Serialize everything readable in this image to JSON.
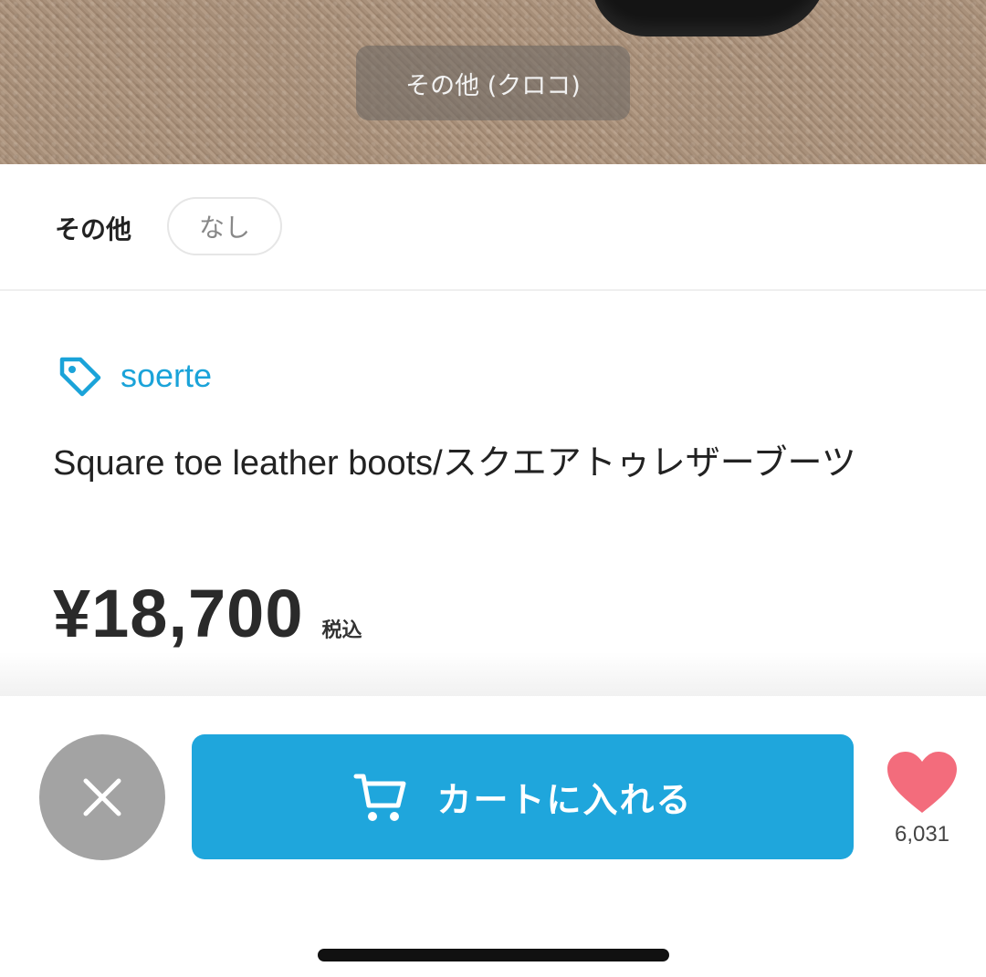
{
  "photo": {
    "caption": "その他 (クロコ)"
  },
  "option": {
    "label": "その他",
    "value": "なし"
  },
  "product": {
    "brand": "soerte",
    "title": "Square toe leather boots/スクエアトゥレザーブーツ",
    "price": "¥18,700",
    "tax_label": "税込"
  },
  "actions": {
    "cart_label": "カートに入れる",
    "like_count": "6,031"
  },
  "colors": {
    "accent": "#1fa6dc",
    "brand_text": "#1aa3d9",
    "heart": "#f36c7c",
    "close_bg": "#a3a3a3"
  },
  "icons": {
    "close": "close-icon",
    "cart": "cart-icon",
    "heart": "heart-icon",
    "tag": "tag-icon"
  }
}
